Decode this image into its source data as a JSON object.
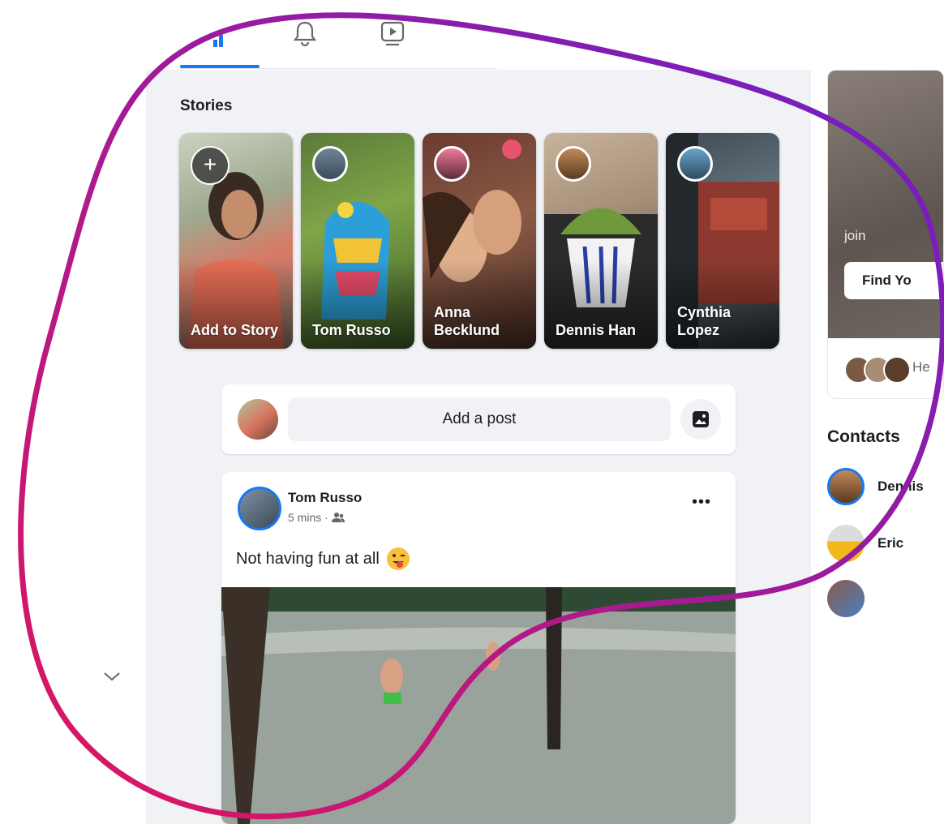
{
  "nav": {
    "tabs": [
      {
        "icon": "home-icon",
        "active": true
      },
      {
        "icon": "bell-icon",
        "active": false
      },
      {
        "icon": "video-icon",
        "active": false
      }
    ]
  },
  "stories": {
    "title": "Stories",
    "items": [
      {
        "label": "Add to Story",
        "type": "add"
      },
      {
        "label": "Tom Russo",
        "type": "friend"
      },
      {
        "label": "Anna Becklund",
        "type": "friend"
      },
      {
        "label": "Dennis Han",
        "type": "friend"
      },
      {
        "label": "Cynthia Lopez",
        "type": "friend"
      }
    ]
  },
  "composer": {
    "placeholder": "Add a post"
  },
  "post": {
    "author": "Tom Russo",
    "time": "5 mins ·",
    "audience_icon": "friends-icon",
    "text": "Not having fun at all",
    "emoji": "😜",
    "more": "•••"
  },
  "sidebar": {
    "promo": {
      "join_text": "join",
      "button_label": "Find Yo",
      "footer_text": "He"
    },
    "contacts": {
      "title": "Contacts",
      "items": [
        {
          "name": "Dennis"
        },
        {
          "name": "Eric"
        },
        {
          "name": ""
        }
      ]
    }
  },
  "colors": {
    "accent": "#1877f2",
    "background": "#f0f2f5",
    "blob_gradient": [
      "#e0155e",
      "#6a1fc9"
    ]
  }
}
